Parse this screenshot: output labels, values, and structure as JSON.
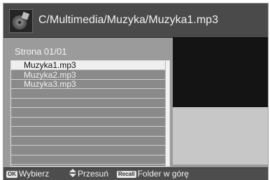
{
  "header": {
    "path": "C/Multimedia/Muzyka/Muzyka1.mp3",
    "icon": "music-disc-icon"
  },
  "list": {
    "page_label": "Strona 01/01",
    "items": [
      {
        "name": "Muzyka1.mp3",
        "selected": true
      },
      {
        "name": "Muzyka2.mp3",
        "selected": false
      },
      {
        "name": "Muzyka3.mp3",
        "selected": false
      },
      {
        "name": "",
        "selected": false
      },
      {
        "name": "",
        "selected": false
      },
      {
        "name": "",
        "selected": false
      },
      {
        "name": "",
        "selected": false
      },
      {
        "name": "",
        "selected": false
      },
      {
        "name": "",
        "selected": false
      },
      {
        "name": "",
        "selected": false
      },
      {
        "name": "",
        "selected": false
      }
    ]
  },
  "footer": {
    "ok_key": "OK",
    "ok_label": "Wybierz",
    "move_label": "Przesuń",
    "recall_key": "Recall",
    "recall_label": "Folder w górę"
  },
  "colors": {
    "selected_row": "#efefef",
    "header": "#4a4a4a",
    "preview": "#141414"
  }
}
